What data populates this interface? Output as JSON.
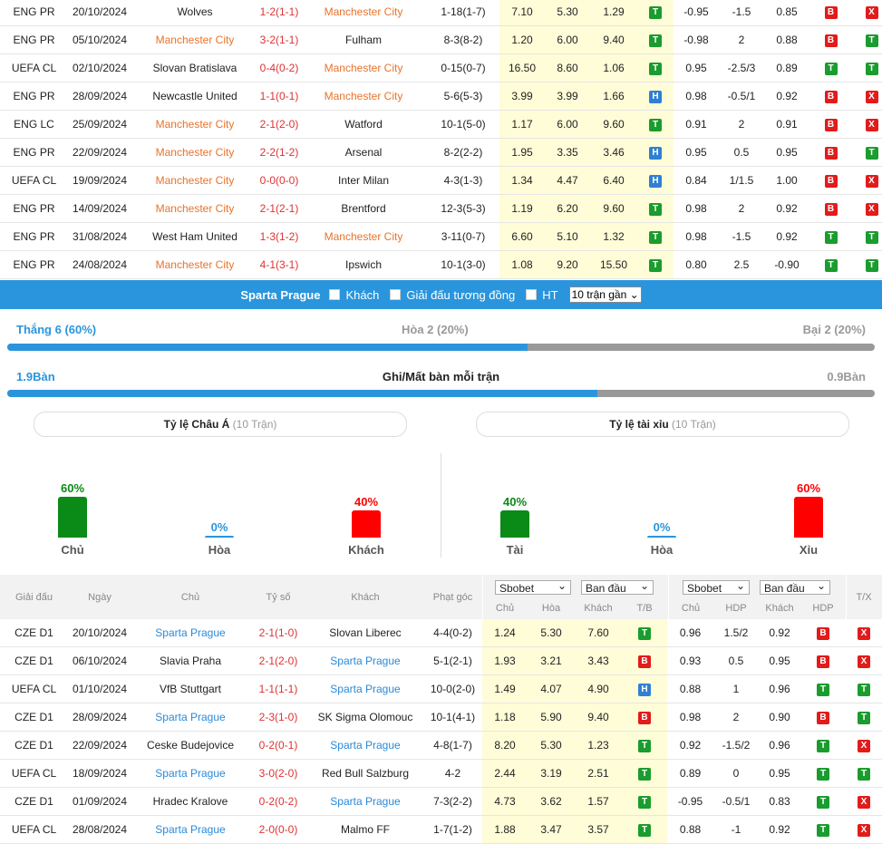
{
  "top_rows": [
    {
      "league": "ENG PR",
      "date": "20/10/2024",
      "home": "Wolves",
      "home_hl": false,
      "score": "1-2(1-1)",
      "away": "Manchester City",
      "away_hl": true,
      "corner": "1-18(1-7)",
      "o1": "7.10",
      "o2": "5.30",
      "o3": "1.29",
      "tb": "T",
      "h1": "-0.95",
      "h2": "-1.5",
      "h3": "0.85",
      "hdp": "B",
      "tx": "X"
    },
    {
      "league": "ENG PR",
      "date": "05/10/2024",
      "home": "Manchester City",
      "home_hl": true,
      "score": "3-2(1-1)",
      "away": "Fulham",
      "away_hl": false,
      "corner": "8-3(8-2)",
      "o1": "1.20",
      "o2": "6.00",
      "o3": "9.40",
      "tb": "T",
      "h1": "-0.98",
      "h2": "2",
      "h3": "0.88",
      "hdp": "B",
      "tx": "T"
    },
    {
      "league": "UEFA CL",
      "date": "02/10/2024",
      "home": "Slovan Bratislava",
      "home_hl": false,
      "score": "0-4(0-2)",
      "away": "Manchester City",
      "away_hl": true,
      "corner": "0-15(0-7)",
      "o1": "16.50",
      "o2": "8.60",
      "o3": "1.06",
      "tb": "T",
      "h1": "0.95",
      "h2": "-2.5/3",
      "h3": "0.89",
      "hdp": "T",
      "tx": "T"
    },
    {
      "league": "ENG PR",
      "date": "28/09/2024",
      "home": "Newcastle United",
      "home_hl": false,
      "score": "1-1(0-1)",
      "away": "Manchester City",
      "away_hl": true,
      "corner": "5-6(5-3)",
      "o1": "3.99",
      "o2": "3.99",
      "o3": "1.66",
      "tb": "H",
      "h1": "0.98",
      "h2": "-0.5/1",
      "h3": "0.92",
      "hdp": "B",
      "tx": "X"
    },
    {
      "league": "ENG LC",
      "date": "25/09/2024",
      "home": "Manchester City",
      "home_hl": true,
      "score": "2-1(2-0)",
      "away": "Watford",
      "away_hl": false,
      "corner": "10-1(5-0)",
      "o1": "1.17",
      "o2": "6.00",
      "o3": "9.60",
      "tb": "T",
      "h1": "0.91",
      "h2": "2",
      "h3": "0.91",
      "hdp": "B",
      "tx": "X"
    },
    {
      "league": "ENG PR",
      "date": "22/09/2024",
      "home": "Manchester City",
      "home_hl": true,
      "score": "2-2(1-2)",
      "away": "Arsenal",
      "away_hl": false,
      "corner": "8-2(2-2)",
      "o1": "1.95",
      "o2": "3.35",
      "o3": "3.46",
      "tb": "H",
      "h1": "0.95",
      "h2": "0.5",
      "h3": "0.95",
      "hdp": "B",
      "tx": "T"
    },
    {
      "league": "UEFA CL",
      "date": "19/09/2024",
      "home": "Manchester City",
      "home_hl": true,
      "score": "0-0(0-0)",
      "away": "Inter Milan",
      "away_hl": false,
      "corner": "4-3(1-3)",
      "o1": "1.34",
      "o2": "4.47",
      "o3": "6.40",
      "tb": "H",
      "h1": "0.84",
      "h2": "1/1.5",
      "h3": "1.00",
      "hdp": "B",
      "tx": "X"
    },
    {
      "league": "ENG PR",
      "date": "14/09/2024",
      "home": "Manchester City",
      "home_hl": true,
      "score": "2-1(2-1)",
      "away": "Brentford",
      "away_hl": false,
      "corner": "12-3(5-3)",
      "o1": "1.19",
      "o2": "6.20",
      "o3": "9.60",
      "tb": "T",
      "h1": "0.98",
      "h2": "2",
      "h3": "0.92",
      "hdp": "B",
      "tx": "X"
    },
    {
      "league": "ENG PR",
      "date": "31/08/2024",
      "home": "West Ham United",
      "home_hl": false,
      "score": "1-3(1-2)",
      "away": "Manchester City",
      "away_hl": true,
      "corner": "3-11(0-7)",
      "o1": "6.60",
      "o2": "5.10",
      "o3": "1.32",
      "tb": "T",
      "h1": "0.98",
      "h2": "-1.5",
      "h3": "0.92",
      "hdp": "T",
      "tx": "T"
    },
    {
      "league": "ENG PR",
      "date": "24/08/2024",
      "home": "Manchester City",
      "home_hl": true,
      "score": "4-1(3-1)",
      "away": "Ipswich",
      "away_hl": false,
      "corner": "10-1(3-0)",
      "o1": "1.08",
      "o2": "9.20",
      "o3": "15.50",
      "tb": "T",
      "h1": "0.80",
      "h2": "2.5",
      "h3": "-0.90",
      "hdp": "T",
      "tx": "T"
    }
  ],
  "filter": {
    "team": "Sparta Prague",
    "opt_away": "Khách",
    "opt_same": "Giải đấu tương đồng",
    "opt_ht": "HT",
    "select": "10 trận gần"
  },
  "summary": {
    "win": "Thắng 6 (60%)",
    "draw": "Hòa 2 (20%)",
    "lose": "Bại 2 (20%)",
    "win_fraction": 0.6,
    "goals_for": "1.9Bàn",
    "goals_title": "Ghi/Mất bàn mỗi trận",
    "goals_against": "0.9Bàn",
    "goals_fraction": 0.68,
    "accent": "#2a95dc"
  },
  "asian": {
    "title": "Tỷ lệ Châu Á",
    "count": "(10 Trận)",
    "cols": [
      {
        "pct": "60%",
        "label": "Chủ",
        "value": 60,
        "color": "#0a8a17"
      },
      {
        "pct": "0%",
        "label": "Hòa",
        "value": 0,
        "color": "#2a95dc"
      },
      {
        "pct": "40%",
        "label": "Khách",
        "value": 40,
        "color": "#f00"
      }
    ]
  },
  "ou": {
    "title": "Tỷ lệ tài xỉu",
    "count": "(10 Trận)",
    "cols": [
      {
        "pct": "40%",
        "label": "Tài",
        "value": 40,
        "color": "#0a8a17"
      },
      {
        "pct": "0%",
        "label": "Hòa",
        "value": 0,
        "color": "#2a95dc"
      },
      {
        "pct": "60%",
        "label": "Xỉu",
        "value": 60,
        "color": "#f00"
      }
    ]
  },
  "header": {
    "league": "Giải đấu",
    "date": "Ngày",
    "home": "Chủ",
    "score": "Tỷ số",
    "away": "Khách",
    "corner": "Phạt góc",
    "book1": "Sbobet",
    "type1": "Ban đầu",
    "book2": "Sbobet",
    "type2": "Ban đầu",
    "sub_home": "Chủ",
    "sub_draw": "Hòa",
    "sub_away": "Khách",
    "sub_tb": "T/B",
    "sub_home2": "Chủ",
    "sub_hdp": "HDP",
    "sub_away2": "Khách",
    "sub_hdp2": "HDP",
    "tx": "T/X"
  },
  "bottom_rows": [
    {
      "league": "CZE D1",
      "date": "20/10/2024",
      "home": "Sparta Prague",
      "home_hl": true,
      "score": "2-1(1-0)",
      "away": "Slovan Liberec",
      "away_hl": false,
      "corner": "4-4(0-2)",
      "o1": "1.24",
      "o2": "5.30",
      "o3": "7.60",
      "tb": "T",
      "h1": "0.96",
      "h2": "1.5/2",
      "h3": "0.92",
      "hdp": "B",
      "tx": "X"
    },
    {
      "league": "CZE D1",
      "date": "06/10/2024",
      "home": "Slavia Praha",
      "home_hl": false,
      "score": "2-1(2-0)",
      "away": "Sparta Prague",
      "away_hl": true,
      "corner": "5-1(2-1)",
      "o1": "1.93",
      "o2": "3.21",
      "o3": "3.43",
      "tb": "B",
      "h1": "0.93",
      "h2": "0.5",
      "h3": "0.95",
      "hdp": "B",
      "tx": "X"
    },
    {
      "league": "UEFA CL",
      "date": "01/10/2024",
      "home": "VfB Stuttgart",
      "home_hl": false,
      "score": "1-1(1-1)",
      "away": "Sparta Prague",
      "away_hl": true,
      "corner": "10-0(2-0)",
      "o1": "1.49",
      "o2": "4.07",
      "o3": "4.90",
      "tb": "H",
      "h1": "0.88",
      "h2": "1",
      "h3": "0.96",
      "hdp": "T",
      "tx": "T"
    },
    {
      "league": "CZE D1",
      "date": "28/09/2024",
      "home": "Sparta Prague",
      "home_hl": true,
      "score": "2-3(1-0)",
      "away": "SK Sigma Olomouc",
      "away_hl": false,
      "corner": "10-1(4-1)",
      "o1": "1.18",
      "o2": "5.90",
      "o3": "9.40",
      "tb": "B",
      "h1": "0.98",
      "h2": "2",
      "h3": "0.90",
      "hdp": "B",
      "tx": "T"
    },
    {
      "league": "CZE D1",
      "date": "22/09/2024",
      "home": "Ceske Budejovice",
      "home_hl": false,
      "score": "0-2(0-1)",
      "away": "Sparta Prague",
      "away_hl": true,
      "corner": "4-8(1-7)",
      "o1": "8.20",
      "o2": "5.30",
      "o3": "1.23",
      "tb": "T",
      "h1": "0.92",
      "h2": "-1.5/2",
      "h3": "0.96",
      "hdp": "T",
      "tx": "X"
    },
    {
      "league": "UEFA CL",
      "date": "18/09/2024",
      "home": "Sparta Prague",
      "home_hl": true,
      "score": "3-0(2-0)",
      "away": "Red Bull Salzburg",
      "away_hl": false,
      "corner": "4-2",
      "o1": "2.44",
      "o2": "3.19",
      "o3": "2.51",
      "tb": "T",
      "h1": "0.89",
      "h2": "0",
      "h3": "0.95",
      "hdp": "T",
      "tx": "T"
    },
    {
      "league": "CZE D1",
      "date": "01/09/2024",
      "home": "Hradec Kralove",
      "home_hl": false,
      "score": "0-2(0-2)",
      "away": "Sparta Prague",
      "away_hl": true,
      "corner": "7-3(2-2)",
      "o1": "4.73",
      "o2": "3.62",
      "o3": "1.57",
      "tb": "T",
      "h1": "-0.95",
      "h2": "-0.5/1",
      "h3": "0.83",
      "hdp": "T",
      "tx": "X"
    },
    {
      "league": "UEFA CL",
      "date": "28/08/2024",
      "home": "Sparta Prague",
      "home_hl": true,
      "score": "2-0(0-0)",
      "away": "Malmo FF",
      "away_hl": false,
      "corner": "1-7(1-2)",
      "o1": "1.88",
      "o2": "3.47",
      "o3": "3.57",
      "tb": "T",
      "h1": "0.88",
      "h2": "-1",
      "h3": "0.92",
      "hdp": "T",
      "tx": "X"
    }
  ]
}
